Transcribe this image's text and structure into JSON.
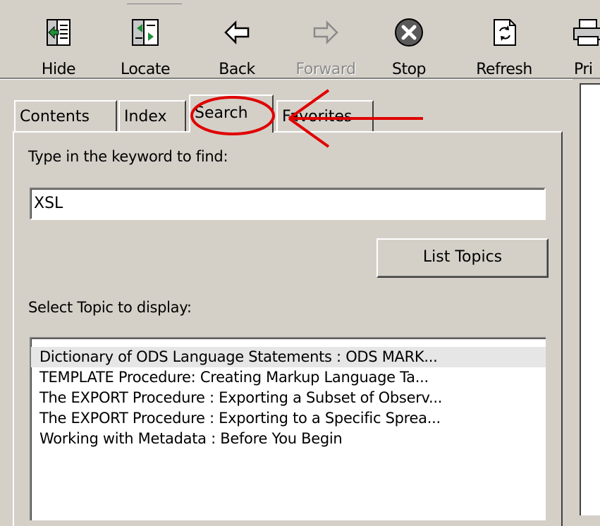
{
  "toolbar": {
    "hide": "Hide",
    "locate": "Locate",
    "back": "Back",
    "forward": "Forward",
    "stop": "Stop",
    "refresh": "Refresh",
    "print_partial": "Pri"
  },
  "tabs": {
    "contents": "Contents",
    "index": "Index",
    "search": "Search",
    "favorites": "Favorites"
  },
  "search": {
    "keyword_label": "Type in the keyword to find:",
    "keyword_value": "XSL",
    "list_topics_button": "List Topics",
    "topic_label": "Select Topic to display:",
    "results": [
      "Dictionary of ODS Language Statements : ODS MARK...",
      "TEMPLATE Procedure: Creating Markup Language Ta...",
      "The EXPORT Procedure : Exporting a Subset of Observ...",
      "The EXPORT Procedure : Exporting to a Specific Sprea...",
      "Working with Metadata : Before You Begin"
    ]
  },
  "colors": {
    "window_bg": "#d4d0c8",
    "annotation": "#e00000",
    "selected_row": "#e6e6e6"
  }
}
